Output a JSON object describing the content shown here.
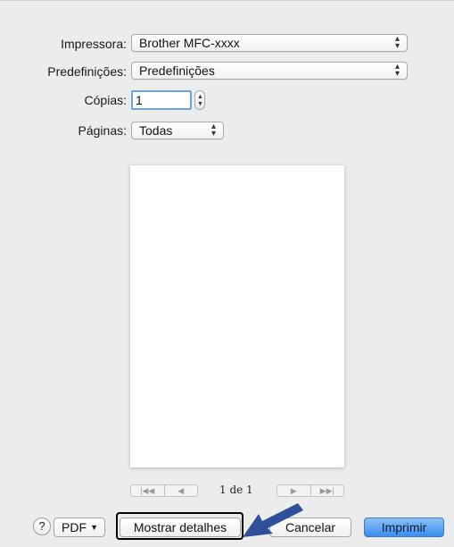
{
  "dialog": {
    "printer": {
      "label": "Impressora:",
      "value": "Brother MFC-xxxx"
    },
    "presets": {
      "label": "Predefinições:",
      "value": "Predefinições"
    },
    "copies": {
      "label": "Cópias:",
      "value": "1"
    },
    "pages": {
      "label": "Páginas:",
      "value": "Todas"
    }
  },
  "preview": {
    "page_indicator": "1 de 1"
  },
  "footer": {
    "help_glyph": "?",
    "pdf_label": "PDF",
    "show_details_label": "Mostrar detalhes",
    "cancel_label": "Cancelar",
    "print_label": "Imprimir"
  },
  "colors": {
    "dialog_bg": "#ececec",
    "accent": "#3b8ff0",
    "arrow": "#2f4f9a"
  },
  "icons": {
    "popup_arrows": "updown-arrows-icon",
    "first_page": "first-page-icon",
    "prev_page": "prev-page-icon",
    "next_page": "next-page-icon",
    "last_page": "last-page-icon",
    "help": "help-icon",
    "annotation_arrow": "annotation-arrow-icon"
  }
}
